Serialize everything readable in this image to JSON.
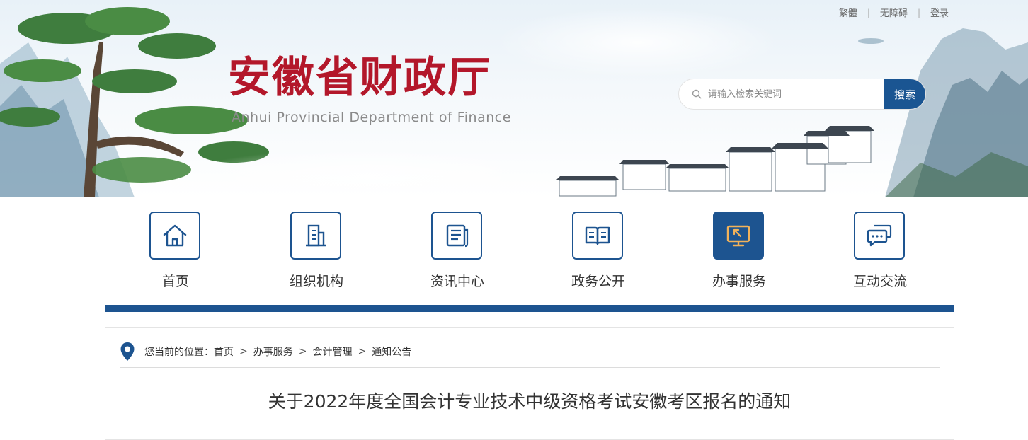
{
  "header": {
    "top_links": [
      "繁體",
      "无障碍",
      "登录"
    ],
    "logo_cn": "安徽省财政厅",
    "logo_en": "Anhui Provincial Department of Finance",
    "search": {
      "placeholder": "请输入检索关键词",
      "button": "搜索"
    }
  },
  "nav": {
    "active_index": 4,
    "items": [
      {
        "label": "首页",
        "icon": "home-icon"
      },
      {
        "label": "组织机构",
        "icon": "building-icon"
      },
      {
        "label": "资讯中心",
        "icon": "news-icon"
      },
      {
        "label": "政务公开",
        "icon": "book-icon"
      },
      {
        "label": "办事服务",
        "icon": "monitor-cursor-icon"
      },
      {
        "label": "互动交流",
        "icon": "chat-icon"
      }
    ]
  },
  "breadcrumb": {
    "prefix": "您当前的位置：",
    "items": [
      "首页",
      "办事服务",
      "会计管理",
      "通知公告"
    ],
    "separator": ">"
  },
  "article": {
    "title": "关于2022年度全国会计专业技术中级资格考试安徽考区报名的通知"
  },
  "colors": {
    "brand_red": "#b3172a",
    "nav_blue": "#1d5490",
    "search_blue": "#1a5592"
  }
}
